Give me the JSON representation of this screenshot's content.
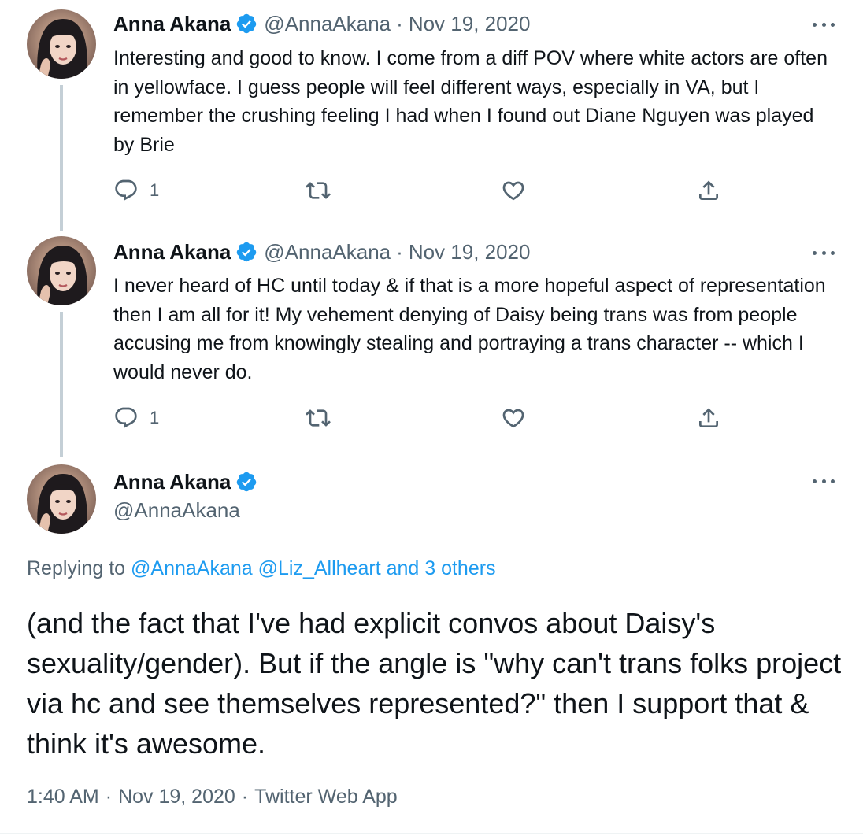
{
  "colors": {
    "text": "#0f1419",
    "secondary": "#536471",
    "accent": "#1d9bf0",
    "thread_line": "#c4cfd6"
  },
  "tweets": [
    {
      "author_name": "Anna Akana",
      "handle": "@AnnaAkana",
      "separator": "·",
      "date": "Nov 19, 2020",
      "verified_icon": "verified-badge-icon",
      "text": "Interesting and good to know. I come from a diff POV where white actors are often in yellowface. I guess people will feel different ways, especially in VA, but I remember the crushing feeling I had when I found out Diane Nguyen was played by Brie",
      "reply_count": "1"
    },
    {
      "author_name": "Anna Akana",
      "handle": "@AnnaAkana",
      "separator": "·",
      "date": "Nov 19, 2020",
      "verified_icon": "verified-badge-icon",
      "text": "I never heard of HC until today & if that is a more hopeful aspect of representation then I am all for it! My vehement denying of Daisy being trans was from people accusing me from knowingly stealing and portraying a trans character -- which I would never do.",
      "reply_count": "1"
    }
  ],
  "main_tweet": {
    "author_name": "Anna Akana",
    "handle": "@AnnaAkana",
    "verified_icon": "verified-badge-icon",
    "replying_prefix": "Replying to",
    "replying_links": "@AnnaAkana @Liz_Allheart and 3 others",
    "text": "(and the fact that I've had explicit convos about Daisy's sexuality/gender). But if the angle is \"why can't trans folks project via hc and see themselves represented?\" then I support that & think it's awesome.",
    "time": "1:40 AM",
    "separator": "·",
    "date": "Nov 19, 2020",
    "source": "Twitter Web App"
  }
}
